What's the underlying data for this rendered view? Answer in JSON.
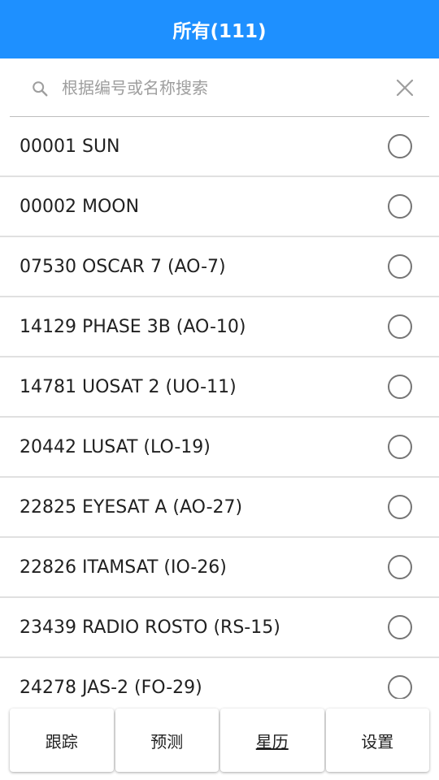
{
  "header": {
    "title": "所有(111)"
  },
  "search": {
    "placeholder": "根据编号或名称搜索",
    "value": ""
  },
  "satellites": [
    {
      "label": "00001 SUN",
      "selected": false
    },
    {
      "label": "00002 MOON",
      "selected": false
    },
    {
      "label": "07530 OSCAR 7 (AO-7)",
      "selected": false
    },
    {
      "label": "14129 PHASE 3B (AO-10)",
      "selected": false
    },
    {
      "label": "14781 UOSAT 2 (UO-11)",
      "selected": false
    },
    {
      "label": "20442 LUSAT (LO-19)",
      "selected": false
    },
    {
      "label": "22825 EYESAT A (AO-27)",
      "selected": false
    },
    {
      "label": "22826 ITAMSAT (IO-26)",
      "selected": false
    },
    {
      "label": "23439 RADIO ROSTO (RS-15)",
      "selected": false
    },
    {
      "label": "24278 JAS-2 (FO-29)",
      "selected": false
    }
  ],
  "bottom_nav": {
    "track": "跟踪",
    "predict": "预测",
    "ephemeris": "星历",
    "settings": "设置",
    "active": "ephemeris"
  },
  "colors": {
    "header_bg": "#1e90ff",
    "header_text": "#ffffff",
    "radio_border": "#757575",
    "divider": "#e0e0e0"
  },
  "icons": {
    "search": "search-icon",
    "clear": "close-icon"
  }
}
